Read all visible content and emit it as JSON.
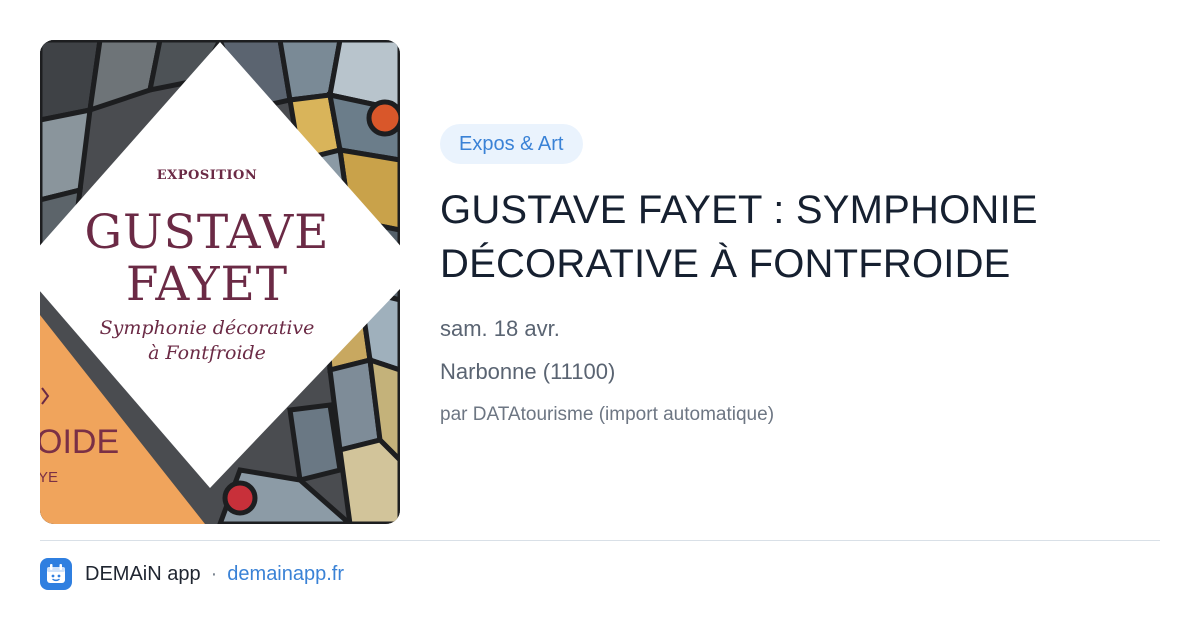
{
  "poster": {
    "eyebrow": "EXPOSITION",
    "name_line1": "GUSTAVE",
    "name_line2": "FAYET",
    "subtitle_line1": "Symphonie décorative",
    "subtitle_line2": "à Fontfroide",
    "orange_text": "OIDE",
    "orange_subtext": "YE"
  },
  "event": {
    "category": "Expos & Art",
    "title": "GUSTAVE FAYET : SYMPHONIE DÉCORATIVE À FONTFROIDE",
    "date": "sam. 18 avr.",
    "location": "Narbonne (11100)",
    "source": "par DATAtourisme (import automatique)"
  },
  "footer": {
    "app_icon": "app-logo-icon",
    "app_name": "DEMAiN app",
    "separator": "·",
    "link": "demainapp.fr"
  },
  "colors": {
    "accent_blue": "#3a82d6",
    "pill_bg": "#eaf3fd",
    "poster_maroon": "#6b2a45",
    "poster_orange": "#f0a45c"
  }
}
